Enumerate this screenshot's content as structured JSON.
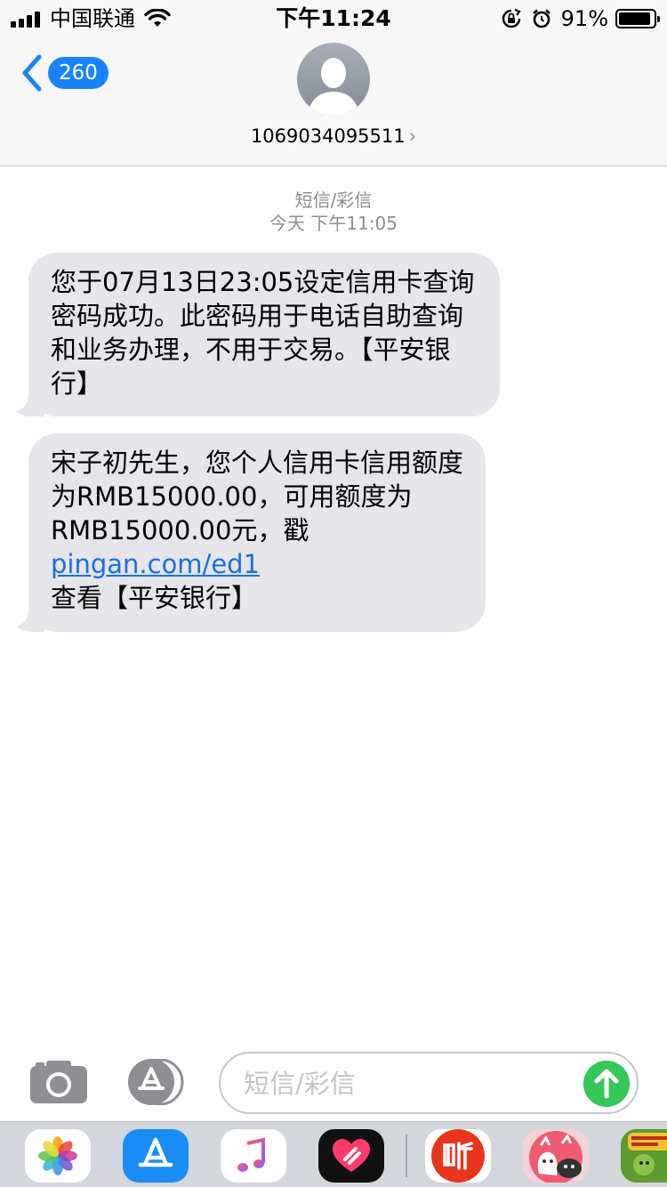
{
  "status_bar": {
    "carrier": "中国联通",
    "time": "下午11:24",
    "battery_percent": "91%",
    "battery_level": 0.91
  },
  "nav": {
    "back_count": "260",
    "contact": "1069034095511",
    "contact_chevron": "›"
  },
  "thread": {
    "type_label": "短信/彩信",
    "timestamp": "今天 下午11:05"
  },
  "messages": [
    {
      "text": "您于07月13日23:05设定信用卡查询密码成功。此密码用于电话自助查询和业务办理，不用于交易。【平安银行】"
    },
    {
      "text_before": "宋子初先生，您个人信用卡信用额度为RMB15000.00，可用额度为RMB15000.00元，戳",
      "link": "pingan.com/ed1",
      "text_after": " 查看【平安银行】"
    }
  ],
  "composer": {
    "placeholder": "短信/彩信"
  },
  "app_drawer": {
    "apps": [
      "photos-icon",
      "app-store-icon",
      "music-icon",
      "digital-touch-icon",
      "listen-app-icon",
      "sticker-app-icon",
      "game-sticker-icon"
    ],
    "colors": {
      "store": "#1a8cf5",
      "music_bg": "#ffffff",
      "touch_bg": "#111111",
      "listen_bg": "#e8361c"
    }
  },
  "colors": {
    "accent": "#1a82fb",
    "bubble": "#e5e5ea",
    "send": "#34c85a",
    "link": "#1a6fe0"
  }
}
